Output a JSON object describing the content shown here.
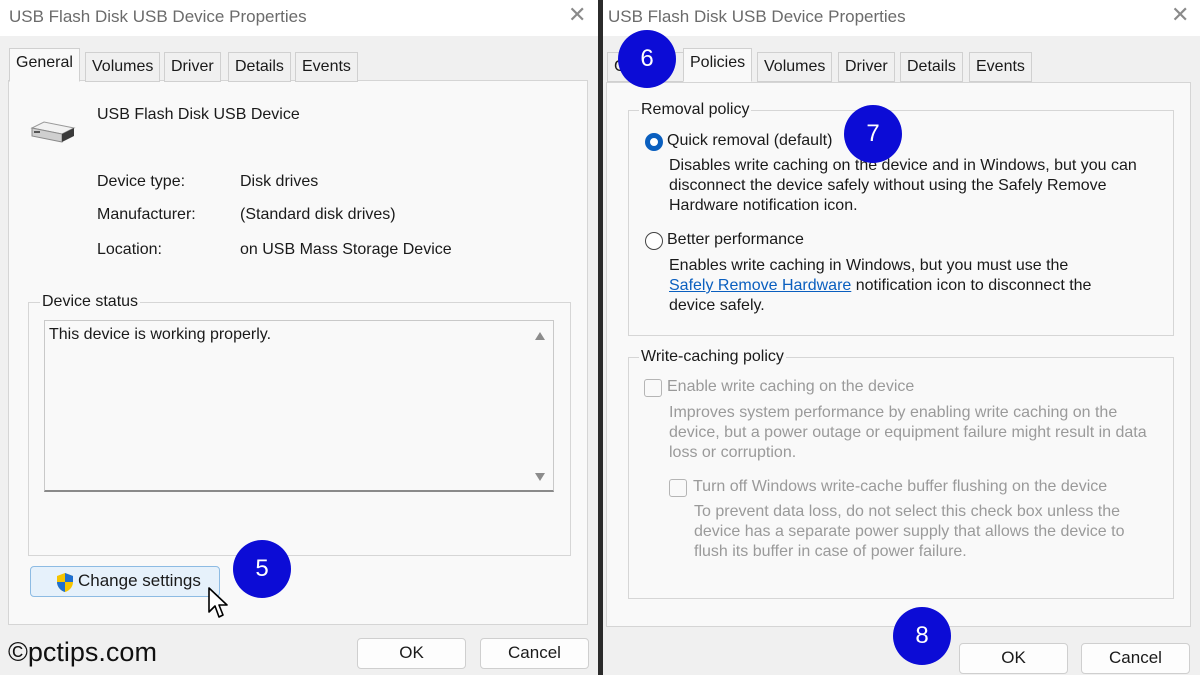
{
  "left": {
    "window_title": "USB Flash Disk USB Device Properties",
    "close_glyph": "✕",
    "tabs": [
      "General",
      "Volumes",
      "Driver",
      "Details",
      "Events"
    ],
    "active_tab": "General",
    "device_name": "USB Flash Disk USB Device",
    "device_icon": "usb-drive-icon",
    "properties": [
      {
        "label": "Device type:",
        "value": "Disk drives"
      },
      {
        "label": "Manufacturer:",
        "value": "(Standard disk drives)"
      },
      {
        "label": "Location:",
        "value": "on USB Mass Storage Device"
      }
    ],
    "device_status": {
      "title": "Device status",
      "text": "This device is working properly."
    },
    "change_settings_label": "Change settings",
    "ok_label": "OK",
    "cancel_label": "Cancel"
  },
  "right": {
    "window_title": "USB Flash Disk USB Device Properties",
    "close_glyph": "✕",
    "tabs": [
      "G",
      "Policies",
      "Volumes",
      "Driver",
      "Details",
      "Events"
    ],
    "active_tab": "Policies",
    "removal_policy": {
      "title": "Removal policy",
      "quick_label": "Quick removal (default)",
      "quick_checked": true,
      "quick_desc": [
        "Disables write caching on the device and in Windows, but you can",
        "disconnect the device safely without using the Safely Remove",
        "Hardware notification icon."
      ],
      "better_label": "Better performance",
      "better_checked": false,
      "better_desc_1": "Enables write caching in Windows, but you must use the",
      "better_desc_link": "Safely Remove Hardware",
      "better_desc_2": " notification icon to disconnect the",
      "better_desc_3": "device safely."
    },
    "write_caching_policy": {
      "title": "Write-caching policy",
      "enable_label": "Enable write caching on the device",
      "enable_checked": false,
      "enable_desc": [
        "Improves system performance by enabling write caching on the",
        "device, but a power outage or equipment failure might result in data",
        "loss or corruption."
      ],
      "flush_label": "Turn off Windows write-cache buffer flushing on the device",
      "flush_checked": false,
      "flush_desc": [
        "To prevent data loss, do not select this check box unless the",
        "device has a separate power supply that allows the device to",
        "flush its buffer in case of power failure."
      ]
    },
    "ok_label": "OK",
    "cancel_label": "Cancel"
  },
  "step_badges": [
    "5",
    "6",
    "7",
    "8"
  ],
  "watermark": "©pctips.com",
  "colors": {
    "badge": "#0c0cd6",
    "link": "#0a5fbf",
    "radio_checked": "#0a5fbf"
  }
}
